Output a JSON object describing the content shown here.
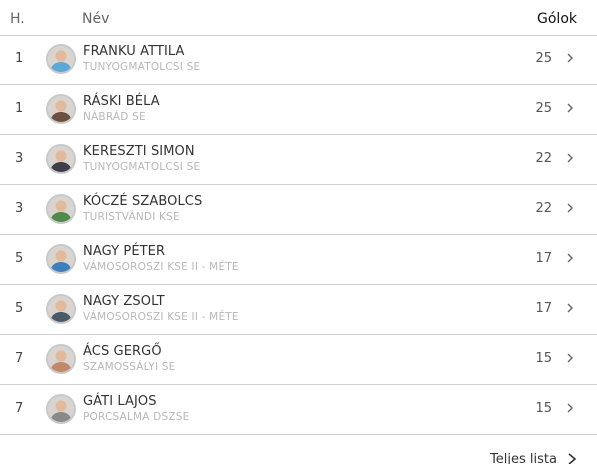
{
  "header": {
    "rank": "H.",
    "name": "Név",
    "goals": "Gólok"
  },
  "rows": [
    {
      "rank": "1",
      "name": "FRANKU ATTILA",
      "club": "TUNYOGMATOLCSI SE",
      "goals": "25",
      "avatar_color": "#5aa8d6"
    },
    {
      "rank": "1",
      "name": "RÁSKI BÉLA",
      "club": "NÁBRÁD SE",
      "goals": "25",
      "avatar_color": "#6b5040"
    },
    {
      "rank": "3",
      "name": "KERESZTI SIMON",
      "club": "TUNYOGMATOLCSI SE",
      "goals": "22",
      "avatar_color": "#3e3e4a"
    },
    {
      "rank": "3",
      "name": "KÓCZÉ SZABOLCS",
      "club": "TURISTVÁNDI KSE",
      "goals": "22",
      "avatar_color": "#4f8a4a"
    },
    {
      "rank": "5",
      "name": "NAGY PÉTER",
      "club": "VÁMOSOROSZI KSE II - MÉTE",
      "goals": "17",
      "avatar_color": "#3e7fc0"
    },
    {
      "rank": "5",
      "name": "NAGY ZSOLT",
      "club": "VÁMOSOROSZI KSE II - MÉTE",
      "goals": "17",
      "avatar_color": "#4a5a6a"
    },
    {
      "rank": "7",
      "name": "ÁCS GERGŐ",
      "club": "SZAMOSSÁLYI SE",
      "goals": "15",
      "avatar_color": "#c08a6a"
    },
    {
      "rank": "7",
      "name": "GÁTI LAJOS",
      "club": "PORCSALMA DSZSE",
      "goals": "15",
      "avatar_color": "#8a8a8a"
    }
  ],
  "footer": {
    "full_list": "Teljes lista"
  }
}
